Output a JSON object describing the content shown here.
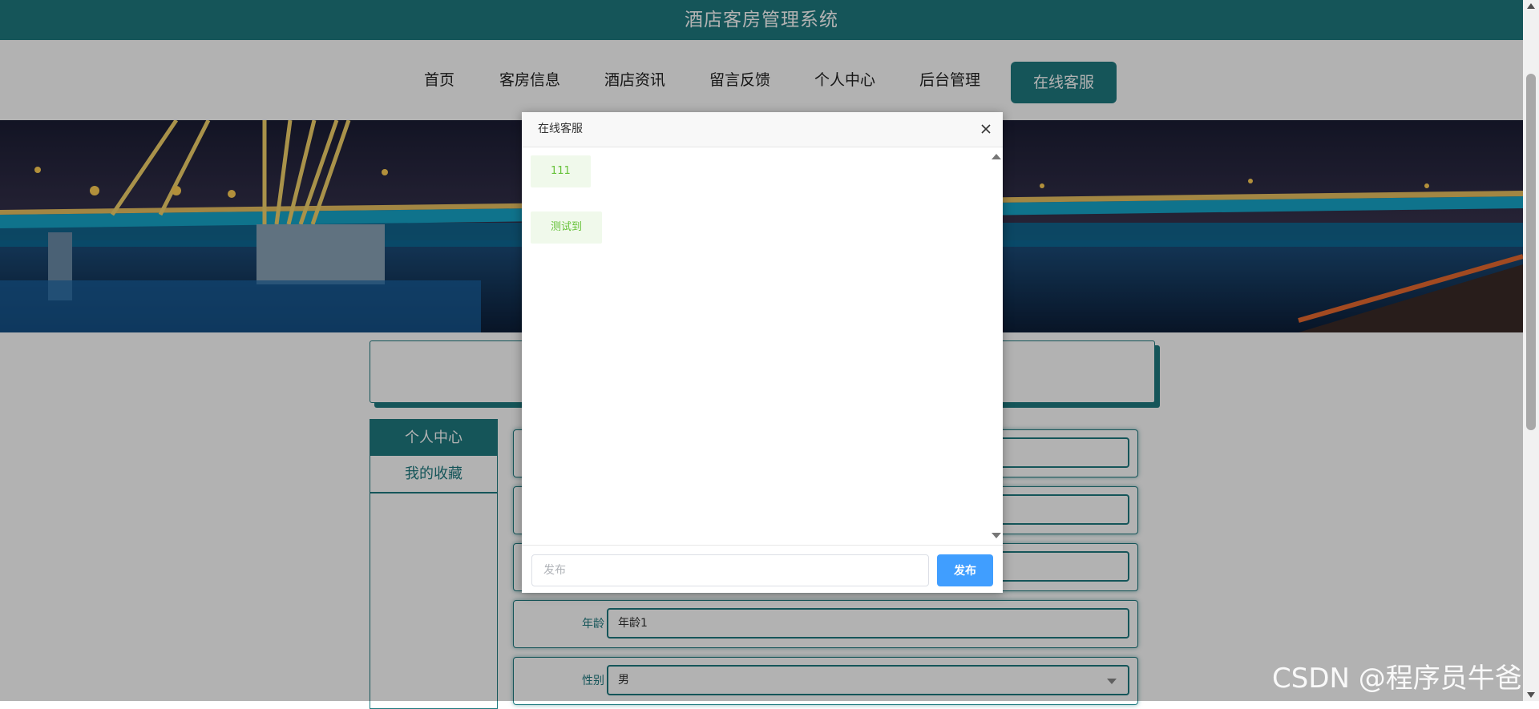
{
  "header": {
    "title": "酒店客房管理系统"
  },
  "nav": {
    "items": [
      "首页",
      "客房信息",
      "酒店资讯",
      "留言反馈",
      "个人中心",
      "后台管理"
    ],
    "active": "在线客服"
  },
  "sidebar": {
    "items": [
      "个人中心",
      "我的收藏"
    ]
  },
  "form": {
    "age_label": "年龄",
    "age_value": "年龄1",
    "gender_label": "性别",
    "gender_value": "男"
  },
  "dialog": {
    "title": "在线客服",
    "messages": [
      "111",
      "测试到"
    ],
    "input_placeholder": "发布",
    "send_label": "发布"
  },
  "watermark": "CSDN @程序员牛爸",
  "colors": {
    "brand": "#1f7a80",
    "send_button": "#409eff",
    "message_text": "#67c23a",
    "message_bg": "#f0f9eb"
  }
}
